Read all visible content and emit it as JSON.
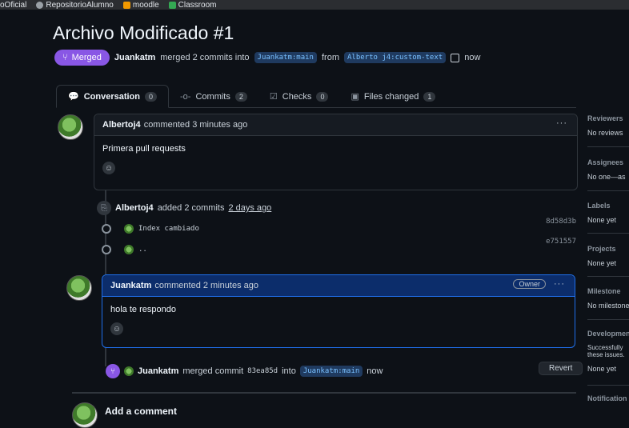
{
  "bookmarks": [
    "oOficial",
    "RepositorioAlumno",
    "moodle",
    "Classroom"
  ],
  "pr": {
    "title": "Archivo Modificado #1",
    "status": "Merged",
    "author": "Juankatm",
    "summary": "merged 2 commits into",
    "base_branch": "Juankatm:main",
    "from_word": "from",
    "head_branch": "Alberto j4:custom-text",
    "time": "now"
  },
  "tabs": [
    {
      "label": "Conversation",
      "count": "0"
    },
    {
      "label": "Commits",
      "count": "2"
    },
    {
      "label": "Checks",
      "count": "0"
    },
    {
      "label": "Files changed",
      "count": "1"
    }
  ],
  "comment1": {
    "author": "Albertoj4",
    "meta": "commented 3 minutes ago",
    "body": "Primera pull requests"
  },
  "event_commits": {
    "author": "Albertoj4",
    "text": "added 2 commits",
    "time": "2 days ago"
  },
  "commits": [
    {
      "message": "Index cambiado",
      "sha": "8d58d3b"
    },
    {
      "message": "..",
      "sha": "e751557"
    }
  ],
  "comment2": {
    "author": "Juankatm",
    "meta": "commented 2 minutes ago",
    "badge": "Owner",
    "body": "hola te respondo"
  },
  "merge_event": {
    "author": "Juankatm",
    "text": "merged commit",
    "sha": "83ea85d",
    "into": "into",
    "branch": "Juankatm:main",
    "time": "now",
    "revert_label": "Revert"
  },
  "add_comment": "Add a comment",
  "sidebar": {
    "reviewers": {
      "heading": "Reviewers",
      "value": "No reviews"
    },
    "assignees": {
      "heading": "Assignees",
      "value": "No one—as"
    },
    "labels": {
      "heading": "Labels",
      "value": "None yet"
    },
    "projects": {
      "heading": "Projects",
      "value": "None yet"
    },
    "milestone": {
      "heading": "Milestone",
      "value": "No milestone"
    },
    "development": {
      "heading": "Developmen",
      "value": "Successfully these issues.",
      "value2": "None yet"
    },
    "notifications": {
      "heading": "Notification"
    }
  }
}
